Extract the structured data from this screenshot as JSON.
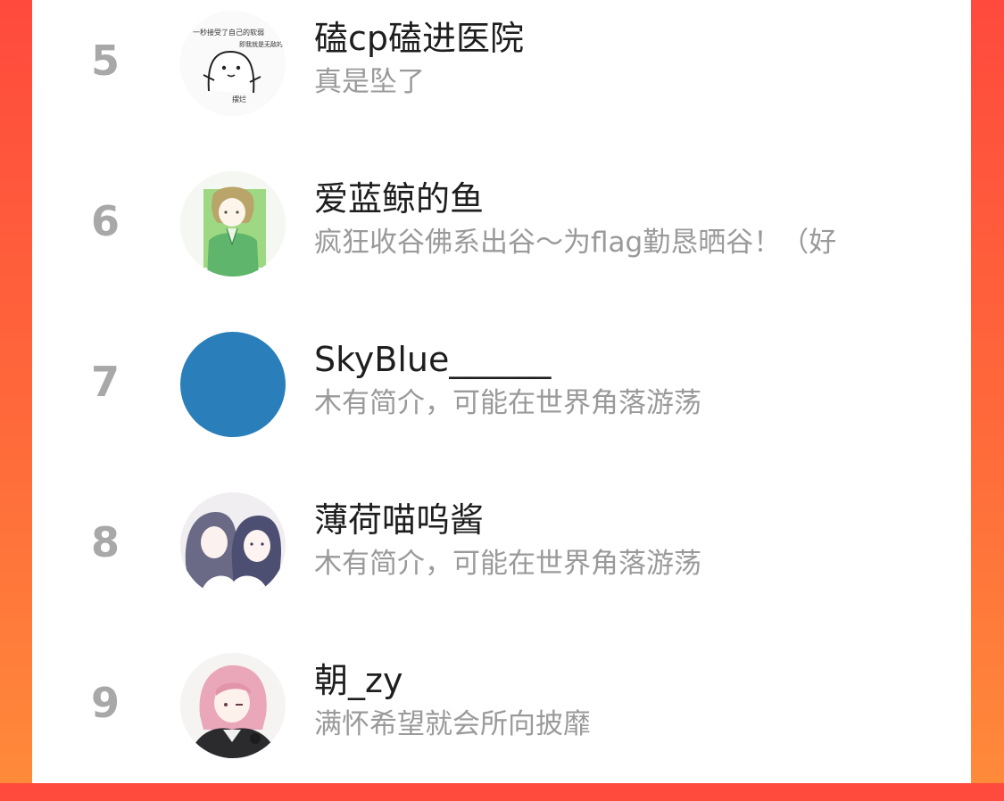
{
  "ranking": {
    "rows": [
      {
        "rank": "5",
        "name": "磕cp磕进医院",
        "bio": "真是坠了",
        "avatar": {
          "icon": "meme-cat-avatar-icon",
          "texts": [
            "一秒接受了自己的软弱",
            "即我就是无敌的",
            "摆烂"
          ]
        }
      },
      {
        "rank": "6",
        "name": "爱蓝鲸的鱼",
        "bio": "疯狂收谷佛系出谷～为flag勤恳晒谷！（好",
        "avatar": {
          "icon": "anime-boy-green-avatar-icon"
        }
      },
      {
        "rank": "7",
        "name": "SkyBlue______",
        "bio": "木有简介，可能在世界角落游荡",
        "avatar": {
          "icon": "solid-blue-avatar-icon",
          "color": "#2a7fba"
        }
      },
      {
        "rank": "8",
        "name": "薄荷喵呜酱",
        "bio": "木有简介，可能在世界角落游荡",
        "avatar": {
          "icon": "two-anime-girls-avatar-icon"
        }
      },
      {
        "rank": "9",
        "name": "朝_zy",
        "bio": "满怀希望就会所向披靡",
        "avatar": {
          "icon": "anime-pink-hair-avatar-icon"
        }
      }
    ]
  },
  "colors": {
    "background_gradient_start": "#ff4a3d",
    "background_gradient_end": "#ff8a3a",
    "panel": "#ffffff",
    "rank_number": "#a8a8a8",
    "name": "#1e1e1e",
    "bio": "#9a9a9a"
  }
}
